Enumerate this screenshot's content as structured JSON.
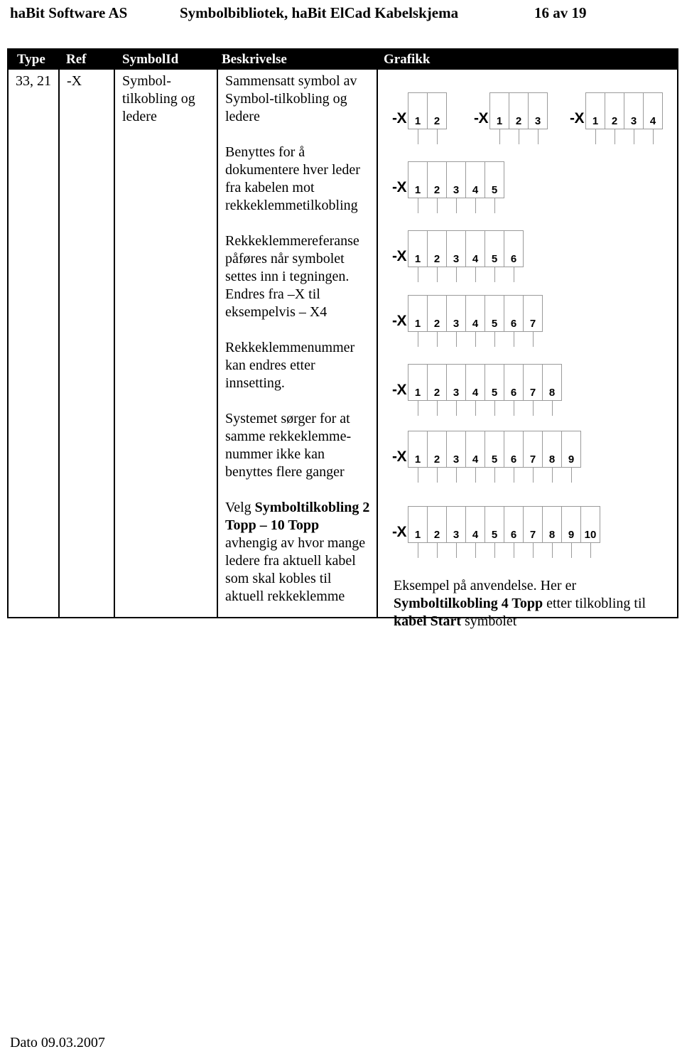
{
  "header": {
    "left": "haBit Software AS",
    "center": "Symbolbibliotek, haBit ElCad Kabelskjema",
    "right": "16 av 19"
  },
  "table": {
    "columns": [
      "Type",
      "Ref",
      "SymbolId",
      "Beskrivelse",
      "Grafikk"
    ],
    "row": {
      "type": "33, 21",
      "ref": "-X",
      "symbolid": "Symbol-tilkobling og ledere",
      "description_paragraphs": [
        "Sammensatt symbol av Symbol-tilkobling og ledere",
        "Benyttes for å dokumentere hver leder fra kabelen mot rekkeklemmetilkobling",
        "Rekkeklemmereferanse påføres når symbolet settes inn i tegningen. Endres fra –X til eksempelvis – X4",
        "Rekkeklemmenummer kan endres etter innsetting.",
        "Systemet sørger for at samme rekkeklemme-nummer ikke kan benyttes flere ganger"
      ],
      "description_last": {
        "lead": "Velg ",
        "bold1": "Symboltilkobling 2 Topp – 10 Topp",
        "tail": " avhengig av hvor mange ledere fra aktuell kabel som skal kobles til aktuell rekkeklemme"
      }
    }
  },
  "graphics": {
    "terminal_label": "-X",
    "blocks": [
      {
        "id": "g2",
        "count": 2,
        "numbers": [
          "1",
          "2"
        ]
      },
      {
        "id": "g3",
        "count": 3,
        "numbers": [
          "1",
          "2",
          "3"
        ]
      },
      {
        "id": "g4",
        "count": 4,
        "numbers": [
          "1",
          "2",
          "3",
          "4"
        ]
      },
      {
        "id": "g5",
        "count": 5,
        "numbers": [
          "1",
          "2",
          "3",
          "4",
          "5"
        ]
      },
      {
        "id": "g6",
        "count": 6,
        "numbers": [
          "1",
          "2",
          "3",
          "4",
          "5",
          "6"
        ]
      },
      {
        "id": "g7",
        "count": 7,
        "numbers": [
          "1",
          "2",
          "3",
          "4",
          "5",
          "6",
          "7"
        ]
      },
      {
        "id": "g8",
        "count": 8,
        "numbers": [
          "1",
          "2",
          "3",
          "4",
          "5",
          "6",
          "7",
          "8"
        ]
      },
      {
        "id": "g9",
        "count": 9,
        "numbers": [
          "1",
          "2",
          "3",
          "4",
          "5",
          "6",
          "7",
          "8",
          "9"
        ]
      },
      {
        "id": "g10",
        "count": 10,
        "numbers": [
          "1",
          "2",
          "3",
          "4",
          "5",
          "6",
          "7",
          "8",
          "9",
          "10"
        ]
      }
    ],
    "caption": {
      "lead": "Eksempel på anvendelse. Her er ",
      "bold1": "Symboltilkobling 4 Topp",
      "mid": " etter tilkobling til ",
      "bold2": "kabel Start",
      "tail": " symbolet"
    }
  },
  "footer": {
    "date": "Dato 09.03.2007"
  },
  "colors": {
    "header_band": "#000000",
    "header_text": "#ffffff",
    "rule": "#000000",
    "symbol_line": "#9a9a9a",
    "page": "#ffffff"
  }
}
